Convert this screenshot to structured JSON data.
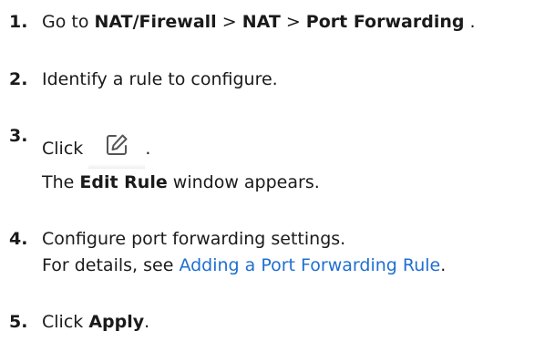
{
  "steps": [
    {
      "number": "1.",
      "prefix": "Go to ",
      "path1": "NAT/Firewall",
      "sep1": " > ",
      "path2": "NAT",
      "sep2": " > ",
      "path3": "Port Forwarding",
      "suffix": " ."
    },
    {
      "number": "2.",
      "text": "Identify a rule to configure."
    },
    {
      "number": "3.",
      "click_label": "Click ",
      "icon": "edit-icon",
      "period": ".",
      "line2_prefix": "The ",
      "line2_bold": "Edit Rule",
      "line2_suffix": " window appears."
    },
    {
      "number": "4.",
      "line1": "Configure port forwarding settings.",
      "line2_prefix": "For details, see ",
      "line2_link": "Adding a Port Forwarding Rule",
      "line2_suffix": "."
    },
    {
      "number": "5.",
      "prefix": "Click ",
      "bold": "Apply",
      "suffix": "."
    }
  ],
  "colors": {
    "text": "#1a1a1a",
    "link": "#1f6fd1",
    "icon": "#555555"
  }
}
